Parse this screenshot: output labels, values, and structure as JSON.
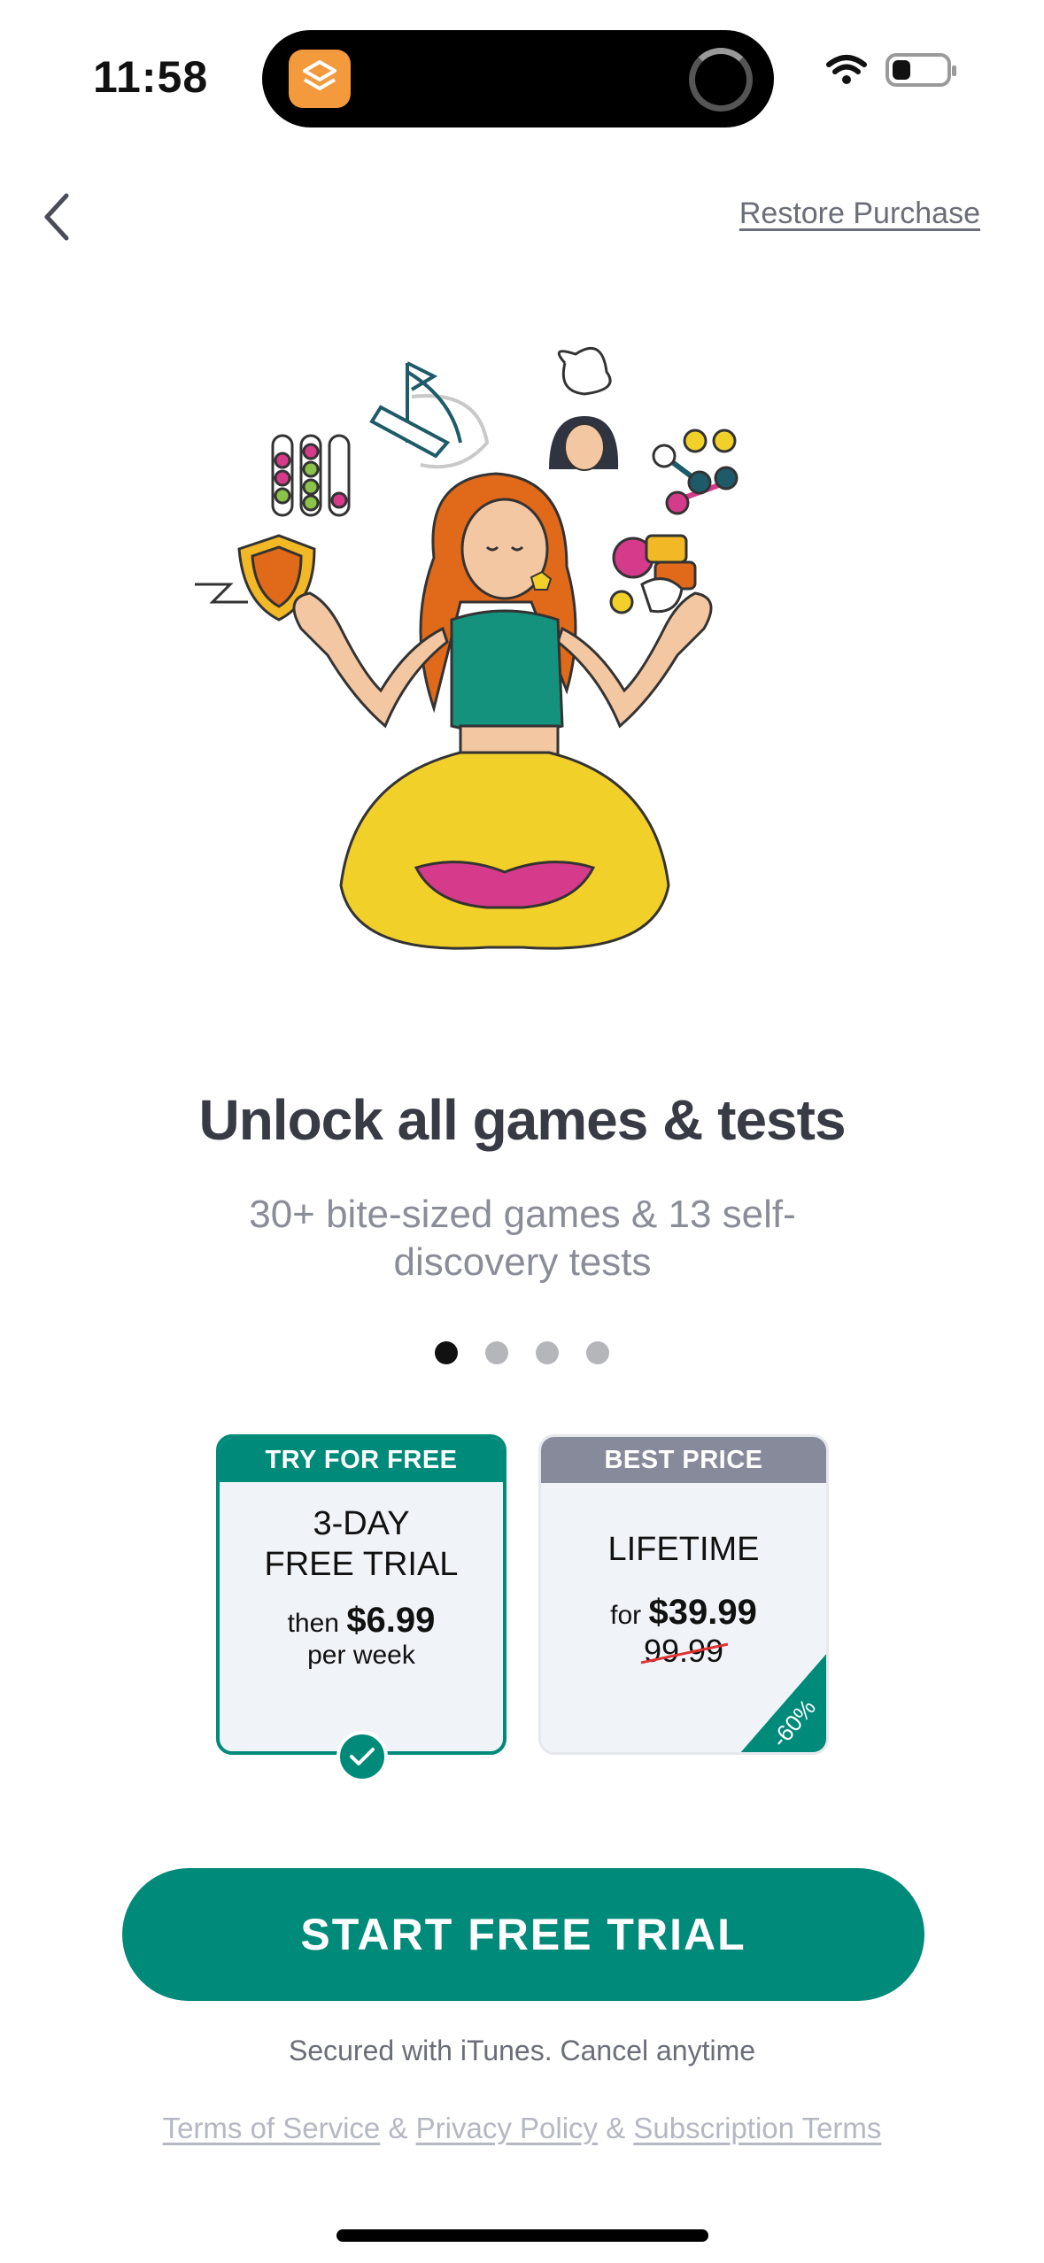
{
  "status_bar": {
    "time": "11:58",
    "icons": [
      "shortcuts-app-icon",
      "activity-spinner-icon",
      "wifi-icon",
      "battery-icon"
    ]
  },
  "header": {
    "back_icon": "chevron-left-icon",
    "restore_label": "Restore Purchase"
  },
  "illustration": {
    "description_icon": "meditating-woman-illustration"
  },
  "hero": {
    "title": "Unlock all games & tests",
    "subtitle": "30+ bite-sized games & 13 self-discovery tests"
  },
  "pager": {
    "count": 4,
    "active_index": 0
  },
  "plans": {
    "trial": {
      "badge": "TRY FOR FREE",
      "name_line1": "3-DAY",
      "name_line2": "FREE TRIAL",
      "then_label": "then",
      "price": "$6.99",
      "period": "per week",
      "selected": true
    },
    "lifetime": {
      "badge": "BEST PRICE",
      "name": "LIFETIME",
      "for_label": "for",
      "price": "$39.99",
      "old_price": "99.99",
      "discount": "-60%"
    }
  },
  "cta": {
    "label": "START FREE TRIAL"
  },
  "footer": {
    "secured": "Secured with iTunes. Cancel anytime",
    "terms": "Terms of Service",
    "privacy": "Privacy Policy",
    "subscription": "Subscription Terms",
    "amp": "&"
  },
  "colors": {
    "accent": "#008a7a",
    "best_price_header": "#868a9b",
    "title": "#383a44",
    "subtitle": "#8a8d97"
  }
}
